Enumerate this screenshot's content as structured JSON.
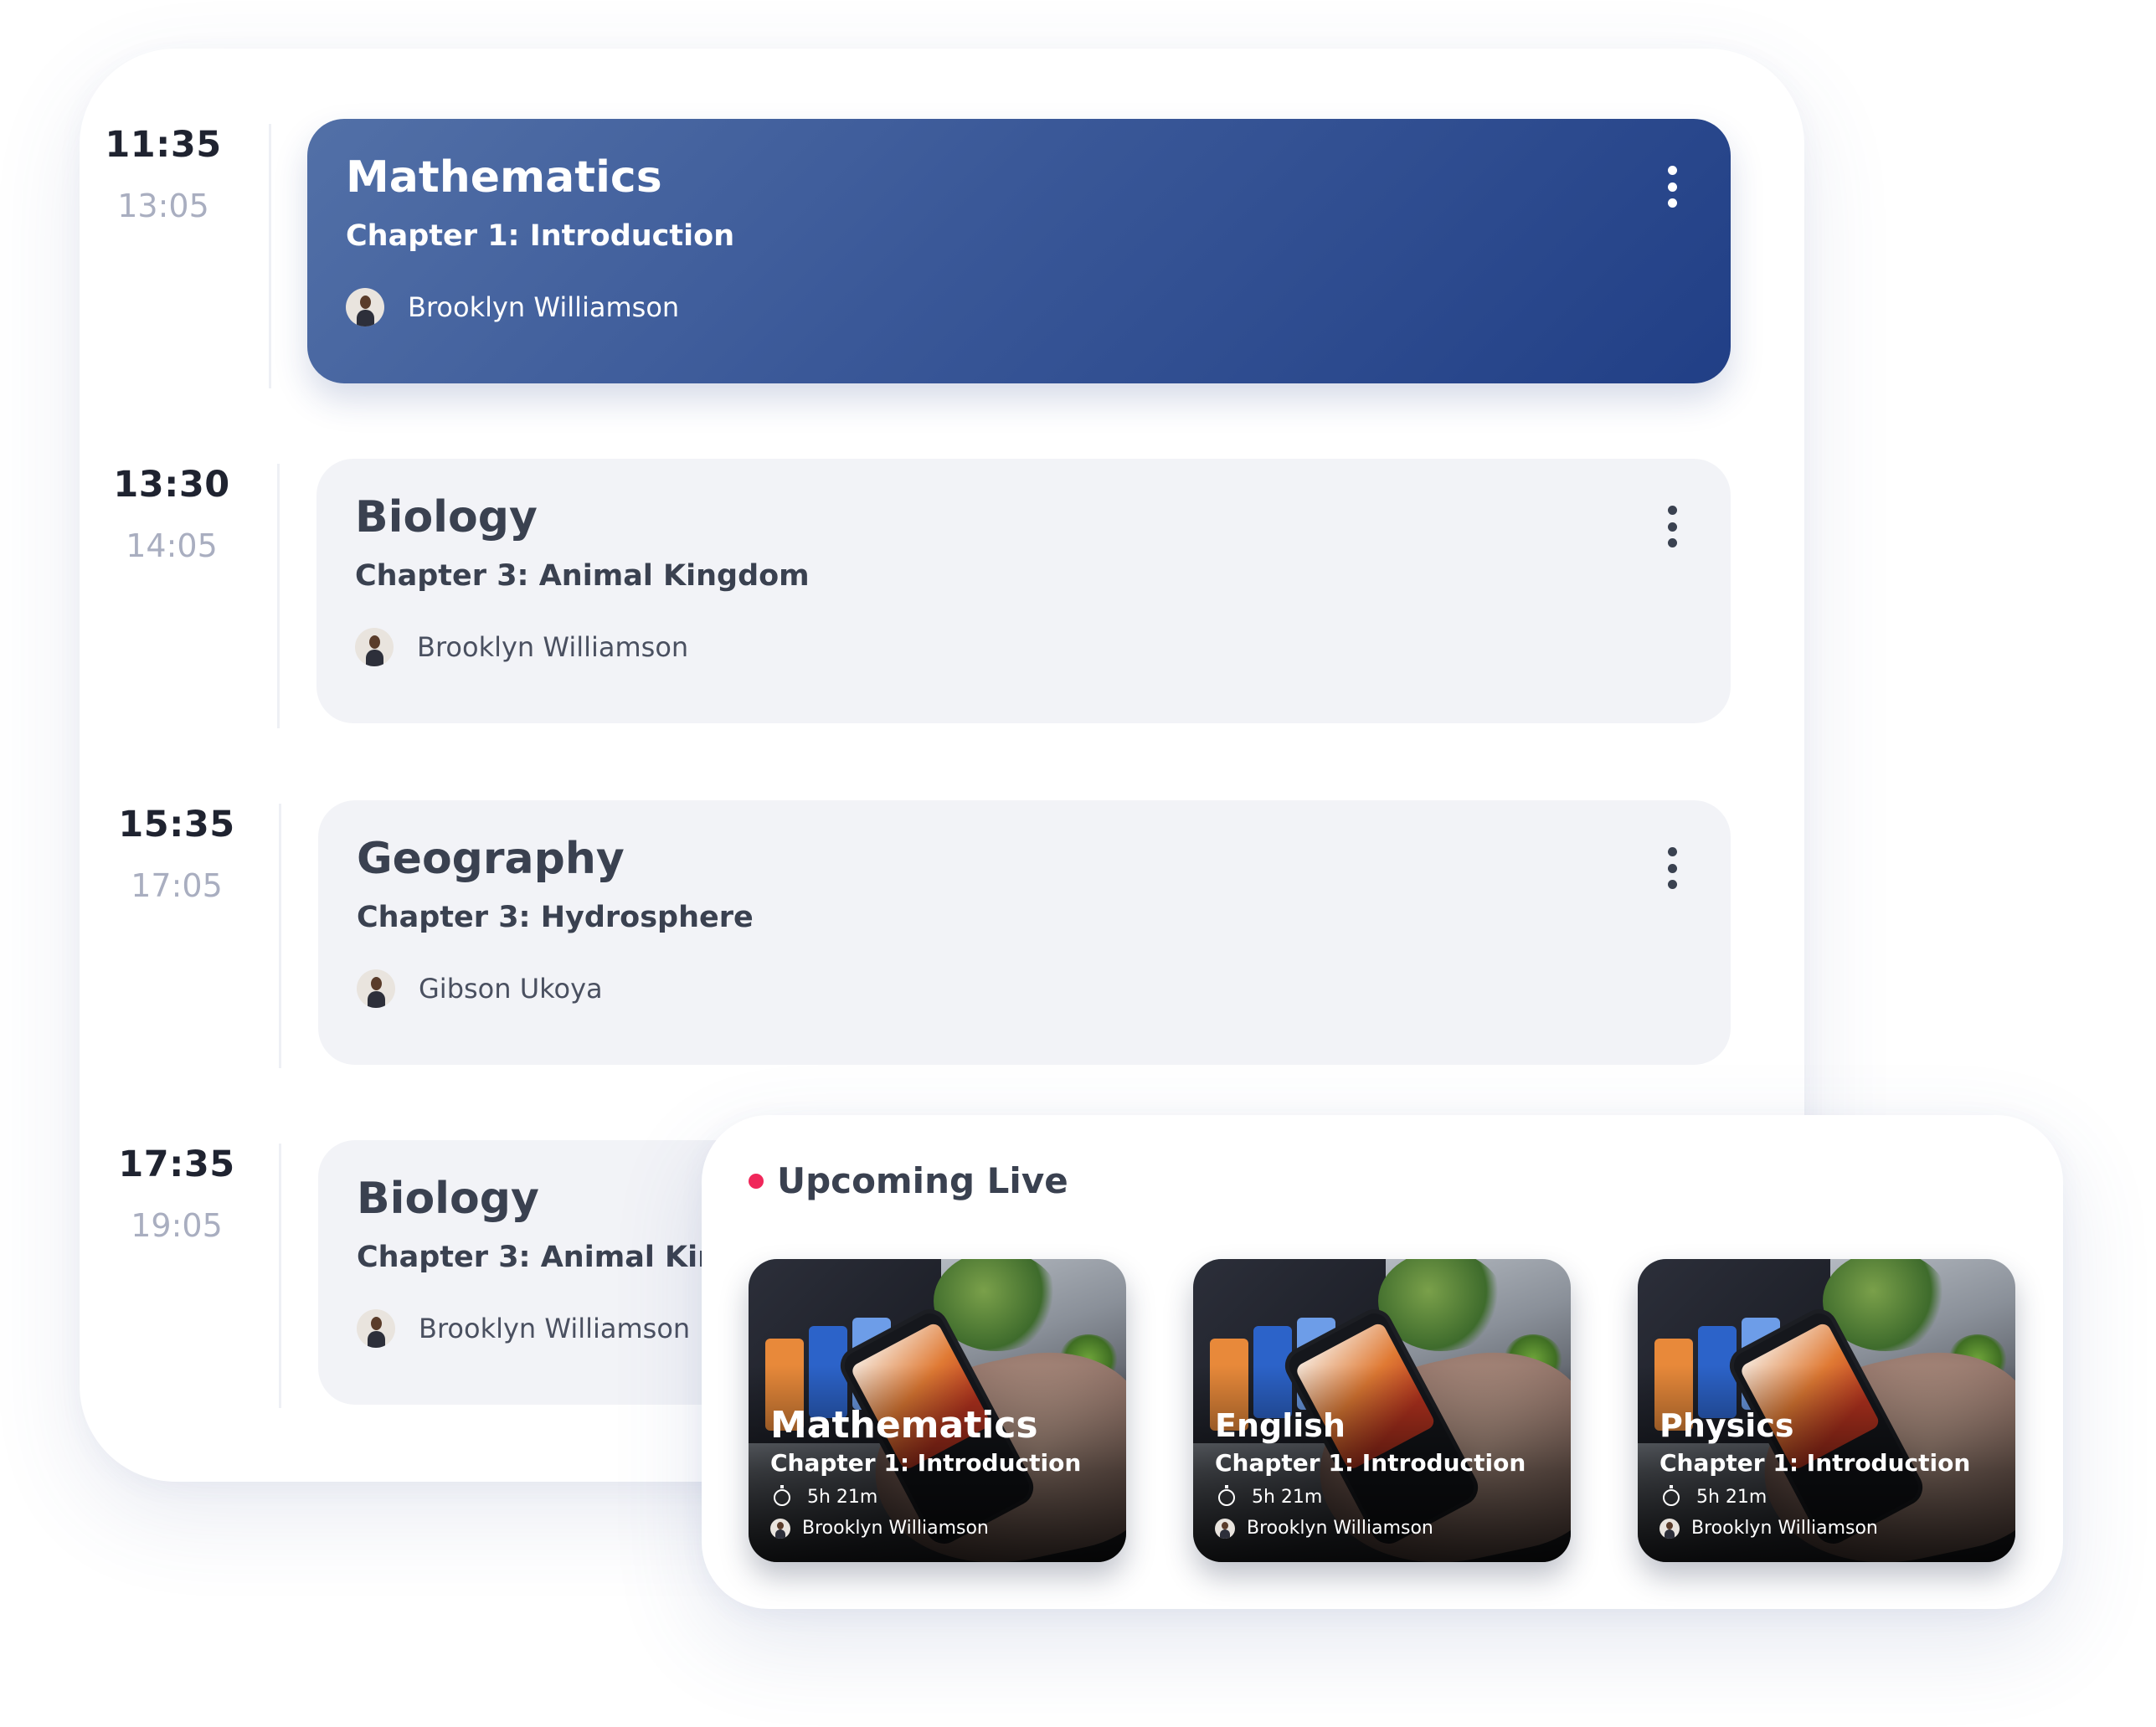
{
  "schedule": [
    {
      "start": "11:35",
      "end": "13:05",
      "subject": "Mathematics",
      "chapter": "Chapter 1: Introduction",
      "teacher": "Brooklyn Williamson",
      "active": true
    },
    {
      "start": "13:30",
      "end": "14:05",
      "subject": "Biology",
      "chapter": "Chapter 3: Animal Kingdom",
      "teacher": "Brooklyn Williamson",
      "active": false
    },
    {
      "start": "15:35",
      "end": "17:05",
      "subject": "Geography",
      "chapter": "Chapter 3: Hydrosphere",
      "teacher": "Gibson Ukoya",
      "active": false
    },
    {
      "start": "17:35",
      "end": "19:05",
      "subject": "Biology",
      "chapter": "Chapter 3: Animal Kingdom",
      "teacher": "Brooklyn Williamson",
      "active": false
    }
  ],
  "upcoming": {
    "title": "Upcoming Live",
    "dot_color": "#f0275a",
    "items": [
      {
        "subject": "Mathematics",
        "chapter": "Chapter 1: Introduction",
        "duration": "5h 21m",
        "teacher": "Brooklyn Williamson"
      },
      {
        "subject": "English",
        "chapter": "Chapter 1: Introduction",
        "duration": "5h 21m",
        "teacher": "Brooklyn Williamson"
      },
      {
        "subject": "Physics",
        "chapter": "Chapter 1: Introduction",
        "duration": "5h 21m",
        "teacher": "Brooklyn Williamson"
      }
    ]
  },
  "colors": {
    "active_card_start": "#5270a7",
    "active_card_end": "#213f86",
    "inactive_card": "#f2f3f7",
    "text_dark": "#3a4150",
    "time_end": "#a9aec0"
  },
  "icons": {
    "menu": "more-vertical-icon",
    "timer": "stopwatch-icon",
    "avatar": "teacher-avatar"
  }
}
